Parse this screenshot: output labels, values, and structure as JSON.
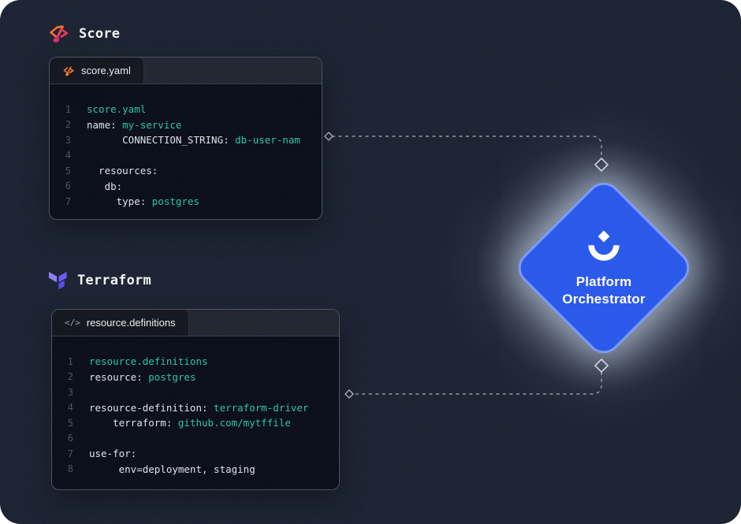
{
  "score": {
    "heading": "Score",
    "tab_label": "score.yaml",
    "lines": [
      [
        [
          "v",
          "score.yaml"
        ]
      ],
      [
        [
          "k",
          "name: "
        ],
        [
          "v",
          "my-service"
        ]
      ],
      [
        [
          "k",
          "      CONNECTION_STRING: "
        ],
        [
          "v",
          "db-user-nam"
        ]
      ],
      [],
      [
        [
          "k",
          "  resources:"
        ]
      ],
      [
        [
          "k",
          "   db:"
        ]
      ],
      [
        [
          "k",
          "     type: "
        ],
        [
          "v",
          "postgres"
        ]
      ]
    ]
  },
  "terraform": {
    "heading": "Terraform",
    "tab_label": "resource.definitions",
    "tab_icon": "</>",
    "lines": [
      [
        [
          "v",
          "resource.definitions"
        ]
      ],
      [
        [
          "k",
          "resource: "
        ],
        [
          "v",
          "postgres"
        ]
      ],
      [],
      [
        [
          "k",
          "resource-definition: "
        ],
        [
          "v",
          "terraform-driver"
        ]
      ],
      [
        [
          "k",
          "    terraform: "
        ],
        [
          "v",
          "github.com/mytffile"
        ]
      ],
      [],
      [
        [
          "k",
          "use-for:"
        ]
      ],
      [
        [
          "k",
          "     env=deployment, staging"
        ]
      ]
    ]
  },
  "orchestrator": {
    "line1": "Platform",
    "line2": "Orchestrator"
  },
  "colors": {
    "background": "#1a2131",
    "code_background": "#080c17",
    "code_accent_teal": "#2bc5a4",
    "code_plain": "#dee3eb",
    "diamond_blue": "#2857ec",
    "diamond_border": "#7b99f4",
    "score_orange": "#f4692e",
    "score_pink": "#dd2a74",
    "terraform_purple": "#6a58f5",
    "connector_gray": "#c2c7d0"
  }
}
